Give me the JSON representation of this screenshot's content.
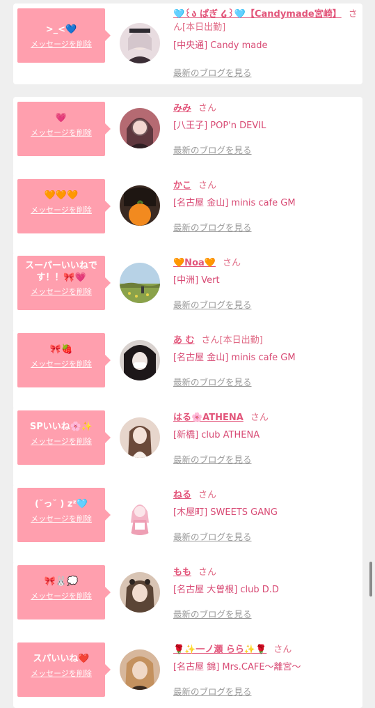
{
  "delete_label": "メッセージを削除",
  "san_label": "さん",
  "blog_label": "最新のブログを見る",
  "colors": {
    "bubble": "#ff9fae",
    "name": "#e2557a",
    "shop": "#d84a74",
    "link_gray": "#999999",
    "background": "#efefef"
  },
  "items": [
    {
      "message": ">_<💙",
      "name": "🩵꒰ა ぱぎ ໒꒱🩵【Candymade宮崎】",
      "extra": "[本日出勤]",
      "shop": "[中央通] Candy made",
      "avatar_colors": [
        "#d8c7cd",
        "#3b2e36"
      ]
    },
    {
      "message": "💗",
      "name": "みみ",
      "extra": "",
      "shop": "[八王子] POP'n DEVIL",
      "avatar_colors": [
        "#c9767c",
        "#2d1e23"
      ]
    },
    {
      "message": "🧡🧡🧡",
      "name": "かこ",
      "extra": "",
      "shop": "[名古屋 金山] minis cafe GM",
      "avatar_colors": [
        "#f28a1f",
        "#3a2a22"
      ]
    },
    {
      "message": "スーパーいいねです！！🎀💗",
      "name": "🧡Noa🧡",
      "extra": "",
      "shop": "[中洲] Vert",
      "avatar_colors": [
        "#b7d2e6",
        "#8aa24a"
      ]
    },
    {
      "message": "🎀🍓",
      "name": "あ む",
      "extra": "[本日出勤]",
      "shop": "[名古屋 金山] minis cafe GM",
      "avatar_colors": [
        "#d9d2cf",
        "#1d1719"
      ]
    },
    {
      "message": "SPいいね🌸✨",
      "name": "はる🌸ATHENA",
      "extra": "",
      "shop": "[新橋] club ATHENA",
      "avatar_colors": [
        "#e7d6cc",
        "#6b4a3a"
      ]
    },
    {
      "message": "(˘っ˘ ) zᶻ🩵",
      "name": "ねる",
      "extra": "",
      "shop": "[木屋町] SWEETS GANG",
      "avatar_colors": [
        "#fdeef2",
        "#ee9fb4"
      ]
    },
    {
      "message": "🎀🐰💭",
      "name": "もも",
      "extra": "",
      "shop": "[名古屋 大曽根] club D.D",
      "avatar_colors": [
        "#d8c4b4",
        "#5b4536"
      ]
    },
    {
      "message": "スパいいね❤️",
      "name": "🌹✨一ノ瀬 らら✨🌹",
      "extra": "",
      "shop": "[名古屋 錦] Mrs.CAFE〜離宮〜",
      "avatar_colors": [
        "#d7b79c",
        "#3a2a1f"
      ]
    }
  ]
}
